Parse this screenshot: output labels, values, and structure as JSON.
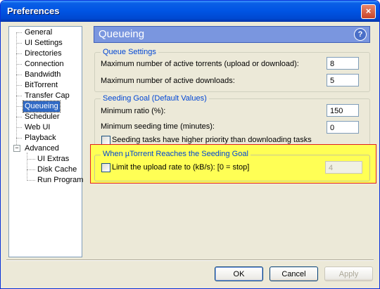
{
  "window": {
    "title": "Preferences",
    "close_glyph": "×"
  },
  "tree": {
    "items": [
      "General",
      "UI Settings",
      "Directories",
      "Connection",
      "Bandwidth",
      "BitTorrent",
      "Transfer Cap",
      "Queueing",
      "Scheduler",
      "Web UI",
      "Playback",
      "Advanced",
      "UI Extras",
      "Disk Cache",
      "Run Program"
    ],
    "selected": "Queueing",
    "expander_glyph": "−"
  },
  "panel": {
    "title": "Queueing",
    "help_glyph": "?"
  },
  "queue_settings": {
    "label": "Queue Settings",
    "max_active_torrents_label": "Maximum number of active torrents (upload or download):",
    "max_active_torrents_value": "8",
    "max_active_downloads_label": "Maximum number of active downloads:",
    "max_active_downloads_value": "5"
  },
  "seeding_goal": {
    "label": "Seeding Goal (Default Values)",
    "min_ratio_label": "Minimum ratio (%):",
    "min_ratio_value": "150",
    "min_seed_time_label": "Minimum seeding time (minutes):",
    "min_seed_time_value": "0",
    "priority_label": "Seeding tasks have higher priority than downloading tasks",
    "priority_checked": false
  },
  "reached_goal": {
    "label": "When µTorrent Reaches the Seeding Goal",
    "limit_label": "Limit the upload rate to (kB/s): [0 = stop]",
    "limit_checked": false,
    "limit_value": "4"
  },
  "buttons": {
    "ok": "OK",
    "cancel": "Cancel",
    "apply": "Apply"
  },
  "colors": {
    "highlight": "#FFFF55",
    "highlight_border": "#E02020",
    "group_label": "#0046D5",
    "selection": "#316AC5"
  }
}
